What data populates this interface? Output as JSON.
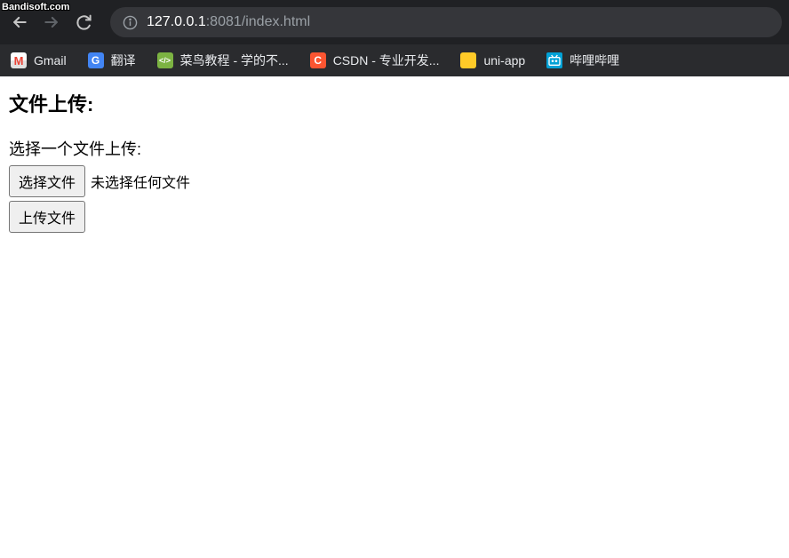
{
  "watermark": "Bandisoft.com",
  "url": {
    "host": "127.0.0.1",
    "port": ":8081",
    "path": "/index.html"
  },
  "bookmarks": [
    {
      "label": "Gmail",
      "iconClass": "bm-gmail",
      "iconText": ""
    },
    {
      "label": "翻译",
      "iconClass": "bm-translate",
      "iconText": "G"
    },
    {
      "label": "菜鸟教程 - 学的不...",
      "iconClass": "bm-runoob",
      "iconText": "</>"
    },
    {
      "label": "CSDN - 专业开发...",
      "iconClass": "bm-csdn",
      "iconText": "C"
    },
    {
      "label": "uni-app",
      "iconClass": "bm-folder",
      "iconText": ""
    },
    {
      "label": "哔哩哔哩",
      "iconClass": "bm-bilibili",
      "iconText": "tv"
    }
  ],
  "page": {
    "heading": "文件上传:",
    "label": "选择一个文件上传:",
    "choose_button": "选择文件",
    "no_file_text": "未选择任何文件",
    "submit_button": "上传文件"
  }
}
